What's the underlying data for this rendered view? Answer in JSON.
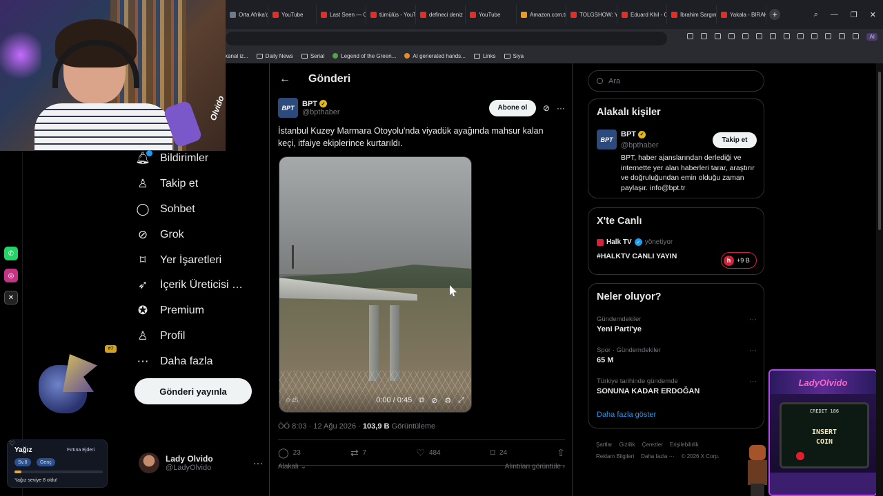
{
  "browser": {
    "tabs": [
      {
        "label": "Orta Afrika'da",
        "icon": "file"
      },
      {
        "label": "YouTube",
        "icon": "youtube"
      },
      {
        "label": "Last Seen — O",
        "icon": "youtube"
      },
      {
        "label": "tümülüs - YouT",
        "icon": "youtube"
      },
      {
        "label": "defineci deniz",
        "icon": "youtube"
      },
      {
        "label": "YouTube",
        "icon": "youtube"
      },
      {
        "label": "Amazon.com.tr",
        "icon": "amazon"
      },
      {
        "label": "TOLGSHOW: Y",
        "icon": "youtube"
      },
      {
        "label": "Eduard Khil - O",
        "icon": "youtube"
      },
      {
        "label": "İbrahim Sargın",
        "icon": "youtube"
      },
      {
        "label": "Yakala - BIRAK",
        "icon": "youtube"
      }
    ],
    "new_tab": "+",
    "ai_label": "AI",
    "bookmarks": [
      {
        "label": "kanal iz...",
        "type": "text"
      },
      {
        "label": "Daily News",
        "type": "folder"
      },
      {
        "label": "Serial",
        "type": "folder"
      },
      {
        "label": "Legend of the Green...",
        "type": "leaf"
      },
      {
        "label": "AI generated hands...",
        "type": "dot"
      },
      {
        "label": "Links",
        "type": "folder"
      },
      {
        "label": "Siya",
        "type": "folder"
      }
    ]
  },
  "webcam": {
    "mic_text": "Olvido"
  },
  "sidebar": {
    "items": [
      {
        "label": "Bildirimler",
        "icon": "bell-icon"
      },
      {
        "label": "Takip et",
        "icon": "person-add-icon"
      },
      {
        "label": "Sohbet",
        "icon": "chat-icon"
      },
      {
        "label": "Grok",
        "icon": "grok-icon"
      },
      {
        "label": "Yer İşaretleri",
        "icon": "bookmark-icon"
      },
      {
        "label": "İçerik Üreticisi St...",
        "icon": "rocket-icon"
      },
      {
        "label": "Premium",
        "icon": "verified-icon"
      },
      {
        "label": "Profil",
        "icon": "person-icon"
      },
      {
        "label": "Daha fazla",
        "icon": "more-circle-icon"
      }
    ],
    "post_button": "Gönderi yayınla",
    "account": {
      "name": "Lady Olvido",
      "handle": "@LadyOlvido",
      "more": "···"
    }
  },
  "overlay": {
    "level_badge": "#7",
    "user": "Yağız",
    "title": "Fırtına Ejderi",
    "tags": [
      "Sv.8",
      "Genç"
    ],
    "progress": 0.08,
    "message": "Yağız seviye 8 oldu!"
  },
  "post": {
    "header_title": "Gönderi",
    "author_name": "BPT",
    "author_handle": "@bpthaber",
    "logo_text": "BPT",
    "subscribe": "Abone ol",
    "text": "İstanbul Kuzey Marmara Otoyolu'nda viyadük ayağında mahsur kalan keçi, itfaiye ekiplerince kurtarıldı.",
    "video": {
      "duration_small": "0:45",
      "time": "0:00 / 0:45"
    },
    "meta_time": "ÖÖ 8:03 · 12 Ağu 2026 · ",
    "views": "103,9 B",
    "views_label": " Görüntüleme",
    "replies": "23",
    "reposts": "7",
    "likes": "484",
    "bookmarks": "24",
    "relevant": "Alakalı",
    "quotes_link": "Alıntıları görüntüle"
  },
  "right": {
    "search_placeholder": "Ara",
    "related": {
      "title": "Alakalı kişiler",
      "name": "BPT",
      "handle": "@bpthaber",
      "follow": "Takip et",
      "bio": "BPT, haber ajanslarından derlediği ve internette yer alan haberleri tarar, araştırır ve doğruluğundan emin olduğu zaman paylaşır. info@bpt.tr"
    },
    "live": {
      "title": "X'te Canlı",
      "host": "Halk TV",
      "host_suffix": "yönetiyor",
      "topic": "#HALKTV CANLI YAYIN",
      "count": "+9 B"
    },
    "trends": {
      "title": "Neler oluyor?",
      "items": [
        {
          "category": "Gündemdekiler",
          "name": "Yeni Parti'ye"
        },
        {
          "category": "Spor · Gündemdekiler",
          "name": "65 M"
        },
        {
          "category": "Türkiye tarihinde gündemde",
          "name": "SONUNA KADAR ERDOĞAN"
        }
      ],
      "show_more": "Daha fazla göster"
    },
    "footer": [
      "Şartlar",
      "Gizlilik",
      "Çerezler",
      "Erişilebilirlik",
      "Reklam Bilgileri",
      "Daha fazla ···",
      "© 2026 X Corp."
    ]
  },
  "arcade": {
    "marquee": "LadyOlvido",
    "credit": "CREDIT 186",
    "insert_line1": "INSERT",
    "insert_line2": "COIN"
  }
}
